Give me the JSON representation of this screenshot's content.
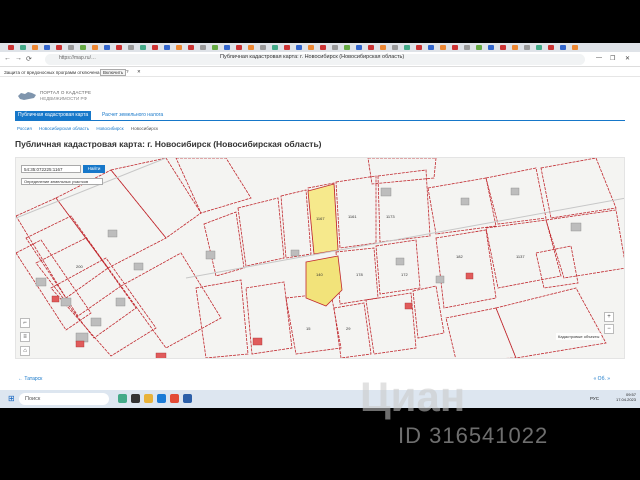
{
  "browser": {
    "url": "https://map.ru/…",
    "page_title": "Публичная кадастровая карта: г. Новосибирск (Новосибирская область)",
    "nav": [
      "←",
      "→",
      "⟳"
    ],
    "window_controls": [
      "—",
      "❐",
      "✕"
    ],
    "notification": {
      "message": "Защита от вредоносных программ отключена",
      "enable_label": "Включить",
      "help_icon": "help-icon",
      "close_label": "✕"
    }
  },
  "portal": {
    "logo_line1": "ПОРТАЛ О КАДАСТРЕ",
    "logo_line2": "НЕДВИЖИМОСТИ РФ",
    "tabs": [
      {
        "label": "Публичная кадастровая карта"
      },
      {
        "label": "Расчет земельного налога"
      }
    ],
    "breadcrumb": [
      "Россия",
      "Новосибирская область",
      "Новосибирск",
      "Новосибирск"
    ],
    "heading": "Публичная кадастровая карта: г. Новосибирск (Новосибирская область)"
  },
  "map": {
    "search_value": "54:35:072225:1167",
    "search_button": "Найти",
    "layer_select": "Определение земельных участков",
    "legend": "Кадастровые объекты",
    "zoom_in": "+",
    "zoom_out": "−",
    "parcel_labels": [
      "140",
      "1167",
      "1161",
      "1173",
      "172",
      "178",
      "182",
      "1137",
      "200",
      "29",
      "15"
    ]
  },
  "footer": {
    "back_label": "← Татарск",
    "forward_label": "« Об. »"
  },
  "taskbar": {
    "search_placeholder": "Поиск",
    "lang": "РУС",
    "time": "09:57",
    "date": "17.04.2023"
  },
  "watermark": {
    "brand": "Циан",
    "id_text": "ID 316541022"
  },
  "colors": {
    "accent": "#1677c9",
    "parcel_border": "#c0272d",
    "highlight": "#f2e37a"
  }
}
